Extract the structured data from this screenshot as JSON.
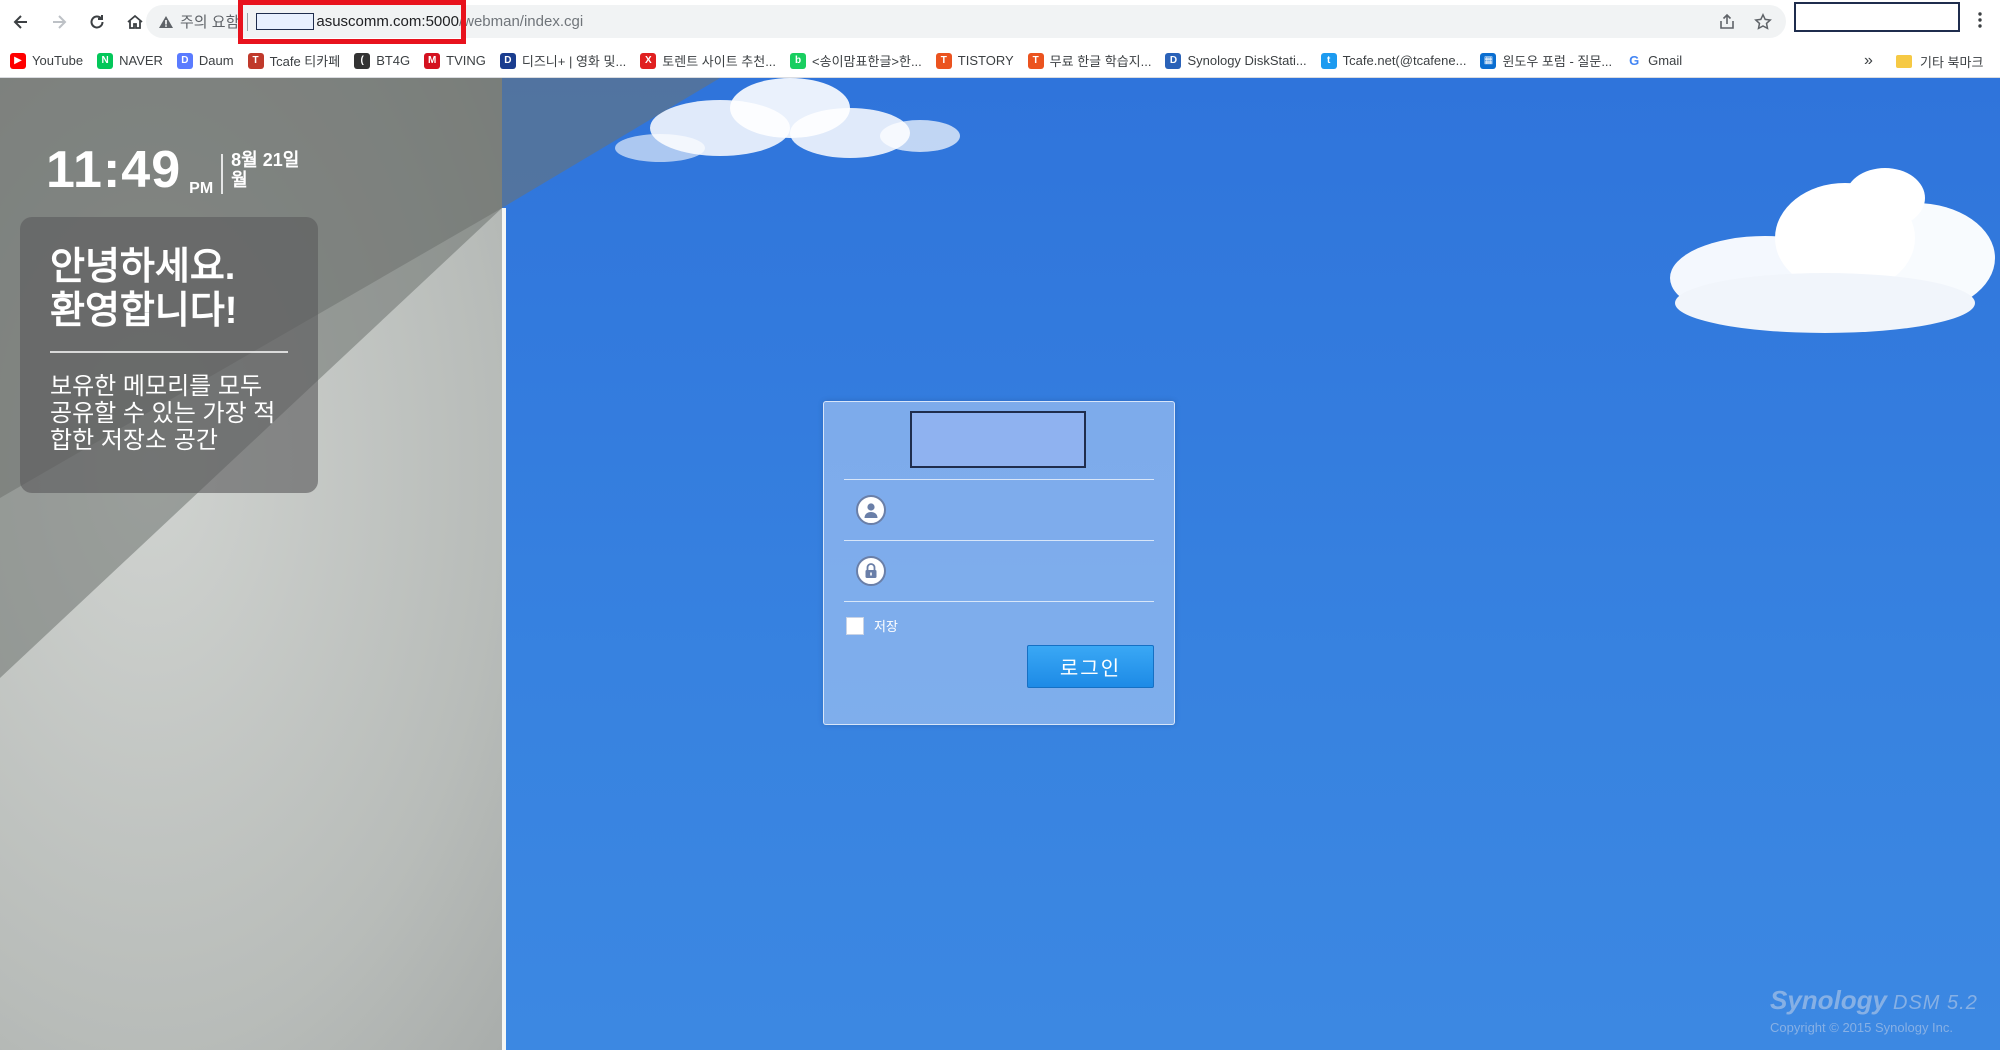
{
  "browser": {
    "security_label": "주의 요함",
    "url_host": "asuscomm.com:5000",
    "url_path": "/webman/index.cgi"
  },
  "bookmarks": [
    {
      "label": "YouTube",
      "icon": "youtube-icon",
      "color": "#ff0000",
      "glyph": "▶"
    },
    {
      "label": "NAVER",
      "icon": "naver-icon",
      "color": "#03c75a",
      "glyph": "N"
    },
    {
      "label": "Daum",
      "icon": "daum-icon",
      "color": "#5a7bff",
      "glyph": "D"
    },
    {
      "label": "Tcafe 티카페",
      "icon": "tcafe-icon",
      "color": "#c0392b",
      "glyph": "T"
    },
    {
      "label": "BT4G",
      "icon": "bt4g-icon",
      "color": "#333333",
      "glyph": "("
    },
    {
      "label": "TVING",
      "icon": "tving-icon",
      "color": "#d4111f",
      "glyph": "M"
    },
    {
      "label": "디즈니+ | 영화 및...",
      "icon": "disney-icon",
      "color": "#1a3d8f",
      "glyph": "D"
    },
    {
      "label": "토렌트 사이트 추천...",
      "icon": "torrent-icon",
      "color": "#e02020",
      "glyph": "X"
    },
    {
      "label": "<송이맘표한글>한...",
      "icon": "blog-icon",
      "color": "#19ce60",
      "glyph": "b"
    },
    {
      "label": "TISTORY",
      "icon": "tistory-icon",
      "color": "#eb531f",
      "glyph": "T"
    },
    {
      "label": "무료 한글 학습지...",
      "icon": "tistory-icon",
      "color": "#eb531f",
      "glyph": "T"
    },
    {
      "label": "Synology DiskStati...",
      "icon": "dsm-icon",
      "color": "#2a62b8",
      "glyph": "D"
    },
    {
      "label": "Tcafe.net(@tcafene...",
      "icon": "twitter-icon",
      "color": "#1d9bf0",
      "glyph": "t"
    },
    {
      "label": "윈도우 포럼 - 질문...",
      "icon": "windows-icon",
      "color": "#0a6ed1",
      "glyph": "▦"
    },
    {
      "label": "Gmail",
      "icon": "google-icon",
      "color": "#ffffff",
      "glyph": "G"
    }
  ],
  "bookmarks_more": "»",
  "bookmarks_folder": "기타 북마크",
  "clock": {
    "time": "11:49",
    "ampm": "PM",
    "date_line1": "8월 21일",
    "date_line2": "월"
  },
  "welcome": {
    "title_line1": "안녕하세요.",
    "title_line2": "환영합니다!",
    "text": "보유한 메모리를 모두 공유할 수 있는 가장 적합한 저장소 공간"
  },
  "login": {
    "username_placeholder": "",
    "password_placeholder": "",
    "remember_label": "저장",
    "submit_label": "로그인"
  },
  "brand": {
    "name": "Synology",
    "version": "DSM 5.2",
    "copyright": "Copyright © 2015 Synology Inc."
  }
}
